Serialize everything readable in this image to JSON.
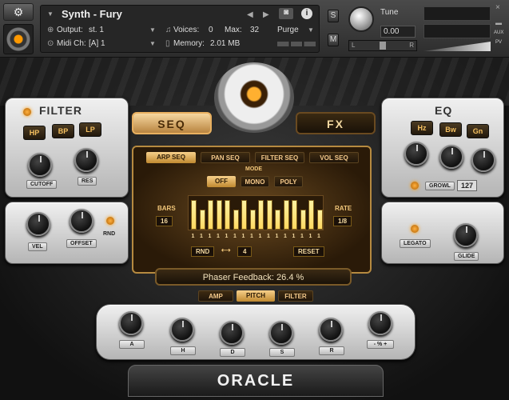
{
  "header": {
    "instrument_name": "Synth - Fury",
    "output_label": "Output:",
    "output_value": "st. 1",
    "voices_label": "Voices:",
    "voices_value": "0",
    "max_label": "Max:",
    "max_value": "32",
    "purge_label": "Purge",
    "midi_label": "Midi Ch:",
    "midi_value": "[A]  1",
    "memory_label": "Memory:",
    "memory_value": "2.01 MB",
    "solo_label": "S",
    "mute_label": "M",
    "tune_label": "Tune",
    "tune_value": "0.00",
    "pan_left": "L",
    "pan_right": "R",
    "aux_label": "AUX",
    "pv_label": "PV",
    "close_label": "×",
    "info_label": "i",
    "prev_label": "◀",
    "next_label": "▶"
  },
  "filter": {
    "title": "FILTER",
    "buttons": [
      "HP",
      "BP",
      "LP"
    ],
    "knobs": [
      "CUTOFF",
      "RES"
    ],
    "knobs2": [
      "VEL",
      "OFFSET"
    ],
    "rnd_label": "RND"
  },
  "eq": {
    "title": "EQ",
    "buttons": [
      "Hz",
      "Bw",
      "Gn"
    ],
    "growl_label": "GROWL",
    "growl_value": "127",
    "legato_label": "LEGATO",
    "glide_label": "GLIDE"
  },
  "center": {
    "seq_tab": "SEQ",
    "fx_tab": "FX",
    "seq_tabs": [
      "ARP SEQ",
      "PAN SEQ",
      "FILTER SEQ",
      "VOL SEQ"
    ],
    "mode_label": "MODE",
    "mode_options": [
      "OFF",
      "MONO",
      "POLY"
    ],
    "bars_label": "BARS",
    "bars_value": "16",
    "rate_label": "RATE",
    "rate_value": "1/8",
    "steps": [
      "1",
      "1",
      "1",
      "1",
      "1",
      "1",
      "1",
      "1",
      "1",
      "1",
      "1",
      "1",
      "1",
      "1",
      "1",
      "1"
    ],
    "step_levels": [
      0.92,
      0.62,
      0.92,
      0.92,
      0.92,
      0.62,
      0.92,
      0.62,
      0.92,
      0.92,
      0.62,
      0.92,
      0.92,
      0.62,
      0.92,
      0.62
    ],
    "rnd_label": "RND",
    "arrow_label": "⟷",
    "rnd_value": "4",
    "reset_label": "RESET",
    "phaser_text": "Phaser Feedback:  26.4 %"
  },
  "env": {
    "tabs": [
      "AMP",
      "PITCH",
      "FILTER"
    ],
    "knobs": [
      "A",
      "H",
      "D",
      "S",
      "R",
      "- % +"
    ]
  },
  "brand": "ORACLE"
}
